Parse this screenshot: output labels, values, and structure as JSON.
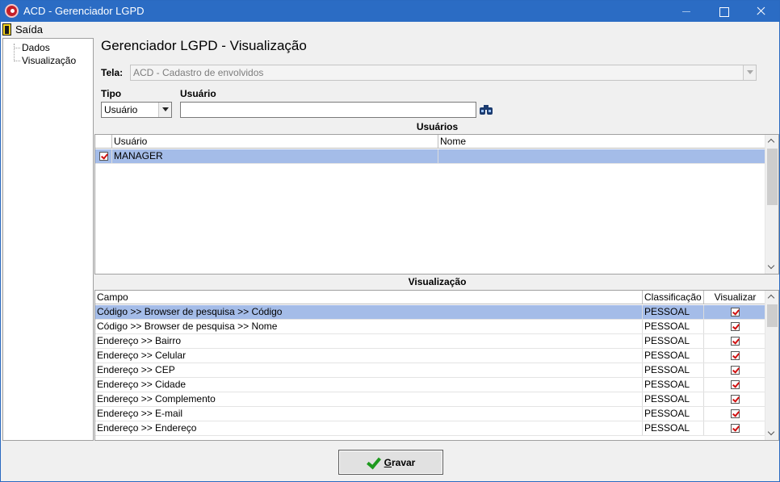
{
  "window": {
    "title": "ACD - Gerenciador LGPD"
  },
  "menu": {
    "exit_label": "Saída"
  },
  "tree": {
    "items": [
      {
        "label": "Dados"
      },
      {
        "label": "Visualização"
      }
    ]
  },
  "page": {
    "title": "Gerenciador LGPD - Visualização"
  },
  "form": {
    "screen_label": "Tela:",
    "screen_value": "ACD - Cadastro de envolvidos",
    "type_label": "Tipo",
    "type_value": "Usuário",
    "user_label": "Usuário",
    "user_value": ""
  },
  "users_section": {
    "title": "Usuários",
    "columns": [
      "Usuário",
      "Nome"
    ],
    "rows": [
      {
        "checked": true,
        "usuario": "MANAGER",
        "nome": ""
      }
    ]
  },
  "view_section": {
    "title": "Visualização",
    "columns": [
      "Campo",
      "Classificação",
      "Visualizar"
    ],
    "rows": [
      {
        "campo": "Código >> Browser de pesquisa >> Código",
        "classificacao": "PESSOAL",
        "visualizar": true
      },
      {
        "campo": "Código >> Browser de pesquisa >> Nome",
        "classificacao": "PESSOAL",
        "visualizar": true
      },
      {
        "campo": "Endereço >> Bairro",
        "classificacao": "PESSOAL",
        "visualizar": true
      },
      {
        "campo": "Endereço >> Celular",
        "classificacao": "PESSOAL",
        "visualizar": true
      },
      {
        "campo": "Endereço >> CEP",
        "classificacao": "PESSOAL",
        "visualizar": true
      },
      {
        "campo": "Endereço >> Cidade",
        "classificacao": "PESSOAL",
        "visualizar": true
      },
      {
        "campo": "Endereço >> Complemento",
        "classificacao": "PESSOAL",
        "visualizar": true
      },
      {
        "campo": "Endereço >> E-mail",
        "classificacao": "PESSOAL",
        "visualizar": true
      },
      {
        "campo": "Endereço >> Endereço",
        "classificacao": "PESSOAL",
        "visualizar": true
      }
    ]
  },
  "actions": {
    "save_label_first": "G",
    "save_label_rest": "ravar"
  },
  "colors": {
    "titlebar": "#2b6cc4",
    "selection": "#a4bce8",
    "check_red": "#d01010",
    "save_check_green": "#1e9a1e"
  },
  "icons": [
    "app-logo-icon",
    "minimize-icon",
    "maximize-icon",
    "close-icon",
    "exit-door-icon",
    "binoculars-icon",
    "green-check-icon"
  ]
}
